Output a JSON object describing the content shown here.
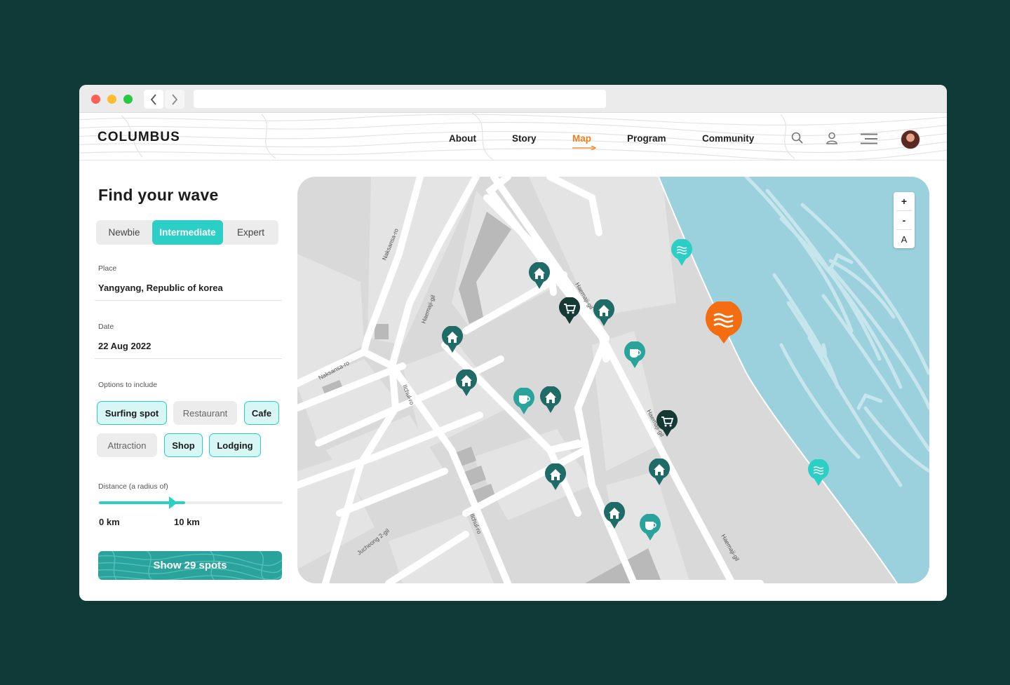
{
  "app": {
    "logo": "COLUMBUS"
  },
  "nav": {
    "about": "About",
    "story": "Story",
    "map": "Map",
    "program": "Program",
    "community": "Community"
  },
  "sidebar": {
    "title": "Find your wave",
    "levels": [
      "Newbie",
      "Intermediate",
      "Expert"
    ],
    "selected_level": "Intermediate",
    "place_label": "Place",
    "place_value": "Yangyang, Republic of korea",
    "date_label": "Date",
    "date_value": "22 Aug 2022",
    "options_label": "Options to include",
    "options": [
      {
        "label": "Surfing spot",
        "selected": true
      },
      {
        "label": "Restaurant",
        "selected": false
      },
      {
        "label": "Cafe",
        "selected": true
      },
      {
        "label": "Attraction",
        "selected": false
      },
      {
        "label": "Shop",
        "selected": true
      },
      {
        "label": "Lodging",
        "selected": true
      }
    ],
    "distance_label": "Distance (a radius of)",
    "distance_min": "0 km",
    "distance_value": "10 km",
    "distance_fill_fraction": 0.47,
    "show_button": "Show 29 spots"
  },
  "map": {
    "zoom_in": "+",
    "zoom_out": "-",
    "zoom_auto": "A",
    "street_labels": [
      "Naksansa-ro",
      "Naksansa-ro",
      "Haemaji-gil",
      "Haemaji-gil",
      "Haemaji-gil",
      "Haemaji-gil",
      "Ilchul-ro",
      "Ilchul-ro",
      "Jucheong 2-gil"
    ],
    "colors": {
      "water": "#9bd0dd",
      "land": "#d9d9d9",
      "lodging_pin": "#1e6b67",
      "shop_pin": "#153a36",
      "cafe_pin": "#2aa39c",
      "surf_pin": "#2bcfc6",
      "selected_pin": "#f46d10"
    }
  }
}
